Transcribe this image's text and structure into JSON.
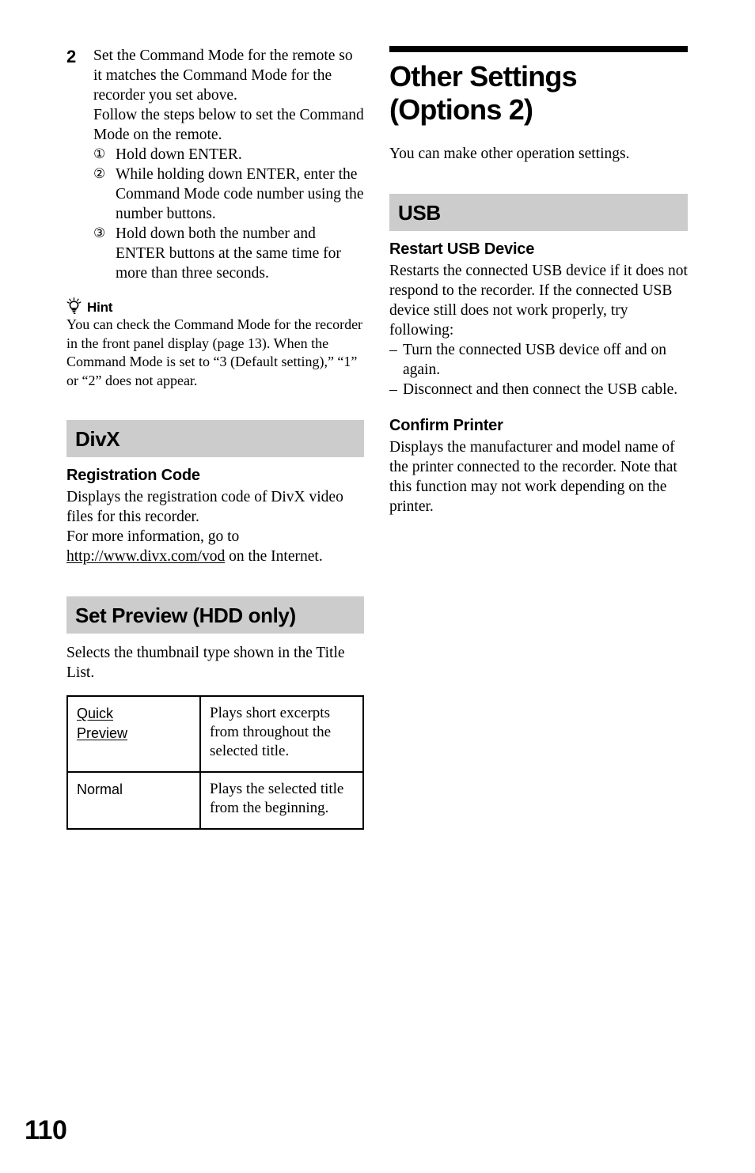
{
  "page": {
    "number": "110"
  },
  "left_column": {
    "step": {
      "number": "2",
      "paragraphs": [
        "Set the Command Mode for the remote so it matches the Command Mode for the recorder you set above.",
        "Follow the steps below to set the Command Mode on the remote."
      ],
      "substeps": [
        {
          "marker": "①",
          "text": "Hold down ENTER."
        },
        {
          "marker": "②",
          "text": "While holding down ENTER, enter the Command Mode code number using the number buttons."
        },
        {
          "marker": "③",
          "text": "Hold down both the number and ENTER buttons at the same time for more than three seconds."
        }
      ]
    },
    "hint": {
      "icon": "lightbulb-icon",
      "label": "Hint",
      "text": "You can check the Command Mode for the recorder in the front panel display (page 13). When the Command Mode is set to “3 (Default setting),” “1” or “2” does not appear."
    },
    "divx_section": {
      "bar_title": "DivX",
      "sub_head": "Registration Code",
      "paragraph_1": "Displays the registration code of DivX video files for this recorder.",
      "paragraph_2_pre": "For more information, go to ",
      "paragraph_2_link": "http://www.divx.com/vod",
      "paragraph_2_post": " on the Internet."
    },
    "set_preview_section": {
      "bar_title": "Set Preview (HDD only)",
      "intro": "Selects the thumbnail type shown in the Title List.",
      "table": {
        "rows": [
          {
            "term_line_1": "Quick",
            "term_line_2": "Preview",
            "term_underlined": true,
            "description": "Plays short excerpts from throughout the selected title."
          },
          {
            "term_line_1": "Normal",
            "term_line_2": "",
            "term_underlined": false,
            "description": "Plays the selected title from the beginning."
          }
        ]
      }
    }
  },
  "right_column": {
    "chapter": {
      "title_line_1": "Other Settings",
      "title_line_2": "(Options 2)",
      "intro": "You can make other operation settings."
    },
    "usb_section": {
      "bar_title": "USB",
      "restart": {
        "sub_head": "Restart USB Device",
        "paragraph": "Restarts the connected USB device if it does not respond to the recorder. If the connected USB device still does not work properly, try following:",
        "bullets": [
          {
            "marker": "–",
            "text": "Turn the connected USB device off and on again."
          },
          {
            "marker": "–",
            "text": "Disconnect and then connect the USB cable."
          }
        ]
      },
      "confirm_printer": {
        "sub_head": "Confirm Printer",
        "paragraph": "Displays the manufacturer and model name of the printer connected to the recorder. Note that this function may not work depending on the printer."
      }
    }
  },
  "colors": {
    "section_bar_gray": "#cccccc",
    "rule_black": "#000000",
    "text_black": "#000000",
    "page_background": "#ffffff"
  }
}
